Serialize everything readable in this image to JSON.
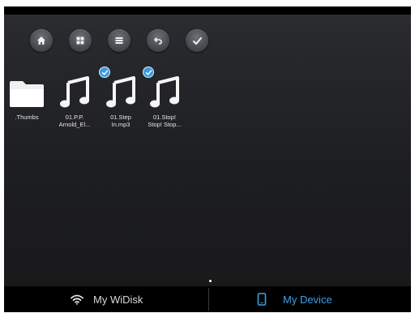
{
  "toolbar": {
    "buttons": [
      {
        "name": "home",
        "icon": "home-icon"
      },
      {
        "name": "grid-view",
        "icon": "grid-icon"
      },
      {
        "name": "list-view",
        "icon": "list-icon"
      },
      {
        "name": "back",
        "icon": "back-arrow-icon"
      },
      {
        "name": "select",
        "icon": "checkmark-icon"
      }
    ]
  },
  "files": [
    {
      "label": ".Thumbs",
      "type": "folder",
      "checked": false
    },
    {
      "label": "01.P.P.\nArnold_El...",
      "type": "music",
      "checked": false
    },
    {
      "label": "01.Step\nIn.mp3",
      "type": "music",
      "checked": true
    },
    {
      "label": "01.Stop!\nStop! Stop...",
      "type": "music",
      "checked": true
    }
  ],
  "bottom_tabs": [
    {
      "label": "My WiDisk",
      "icon": "wifi-icon",
      "active": false
    },
    {
      "label": "My Device",
      "icon": "phone-icon",
      "active": true
    }
  ],
  "colors": {
    "active_tab": "#3aa0e8",
    "inactive_tab": "#d8d8d8",
    "check_badge": "#3b9be0"
  }
}
